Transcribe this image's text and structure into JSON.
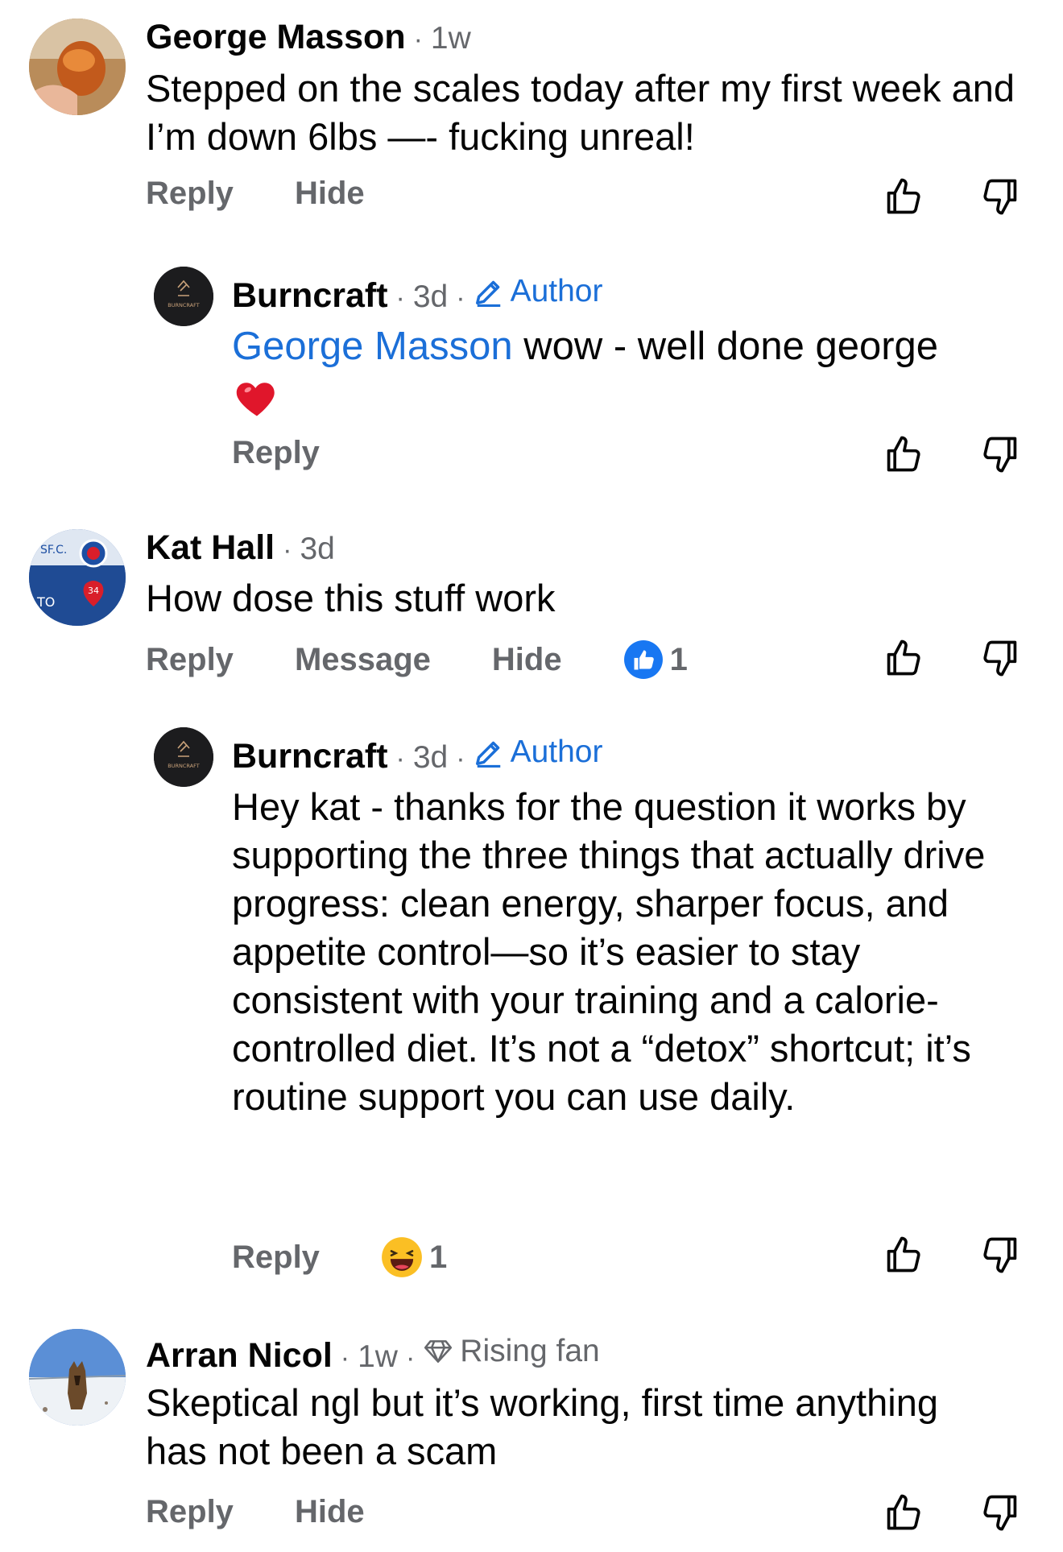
{
  "comments": [
    {
      "name": "George Masson",
      "time": "1w",
      "text": "Stepped on the scales today after my first week and I’m down 6lbs —- fucking unreal!",
      "actions": [
        "Reply",
        "Hide"
      ]
    },
    {
      "name": "Burncraft",
      "time": "3d",
      "badge": "Author",
      "mention": "George Masson",
      "text": " wow - well done george",
      "emoji": "❤️",
      "actions": [
        "Reply"
      ]
    },
    {
      "name": "Kat Hall",
      "time": "3d",
      "text": "How dose this stuff work",
      "actions": [
        "Reply",
        "Message",
        "Hide"
      ],
      "reaction_count": "1"
    },
    {
      "name": "Burncraft",
      "time": "3d",
      "badge": "Author",
      "text": "Hey kat - thanks for the question it works by supporting the three things that actually drive progress: clean energy, sharper focus, and appetite control—so it’s easier to stay consistent with your training and a calorie-controlled diet. It’s not a “detox” shortcut; it’s routine support you can use daily.",
      "actions": [
        "Reply"
      ],
      "reaction_count": "1"
    },
    {
      "name": "Arran Nicol",
      "time": "1w",
      "badge": "Rising fan",
      "text": "Skeptical ngl but it’s working, first time anything has not been a scam",
      "actions": [
        "Reply",
        "Hide"
      ]
    }
  ],
  "logo_text": "BURNCRAFT",
  "colors": {
    "link": "#1b6fd8",
    "secondary_text": "#65676b",
    "like_blue": "#1877f2",
    "heart_red": "#e0162b",
    "emoji_yellow": "#fbbf24"
  },
  "icons": {
    "like": "thumbs-up-icon",
    "dislike": "thumbs-down-icon",
    "author": "pencil-icon",
    "rising_fan": "diamond-icon",
    "like_reaction": "like-reaction-icon",
    "haha_reaction": "haha-reaction-icon"
  }
}
